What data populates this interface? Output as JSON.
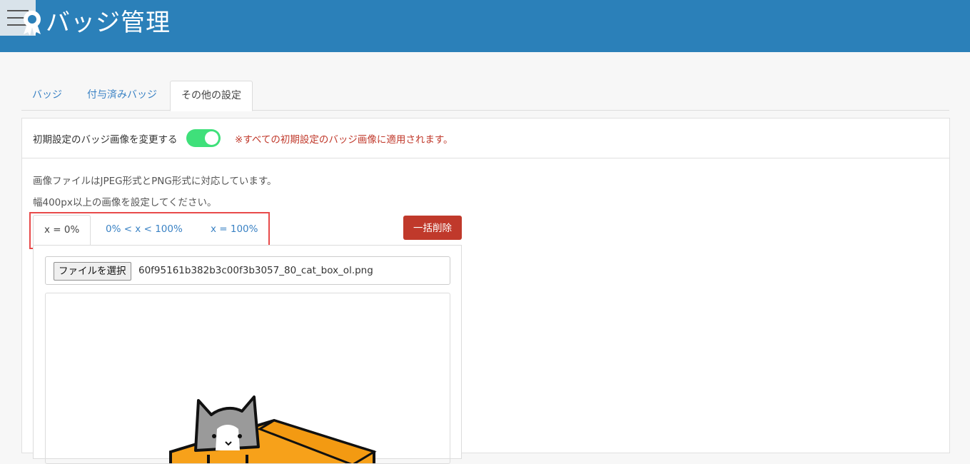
{
  "header": {
    "title": "バッジ管理",
    "menu_icon": "hamburger-menu-icon",
    "badge_icon": "award-ribbon-icon",
    "bar_color": "#2b80b9"
  },
  "main_tabs": [
    {
      "label": "バッジ",
      "active": false
    },
    {
      "label": "付与済みバッジ",
      "active": false
    },
    {
      "label": "その他の設定",
      "active": true
    }
  ],
  "settings": {
    "toggle_label": "初期設定のバッジ画像を変更する",
    "toggle_on": true,
    "toggle_color": "#3fe07a",
    "toggle_note": "※すべての初期設定のバッジ画像に適用されます。",
    "info_line_1": "画像ファイルはJPEG形式とPNG形式に対応しています。",
    "info_line_2": "幅400px以上の画像を設定してください。"
  },
  "sub_tabs": [
    {
      "label": "x = 0%",
      "active": true
    },
    {
      "label": "0% < x < 100%",
      "active": false
    },
    {
      "label": "x = 100%",
      "active": false
    }
  ],
  "bulk_delete_label": "一括削除",
  "upload": {
    "button_label": "ファイルを選択",
    "file_name": "60f95161b382b3c00f3b3057_80_cat_box_ol.png"
  },
  "colors": {
    "accent": "#3a82c4",
    "danger": "#c0392b",
    "highlight_border": "#e84a4a"
  }
}
